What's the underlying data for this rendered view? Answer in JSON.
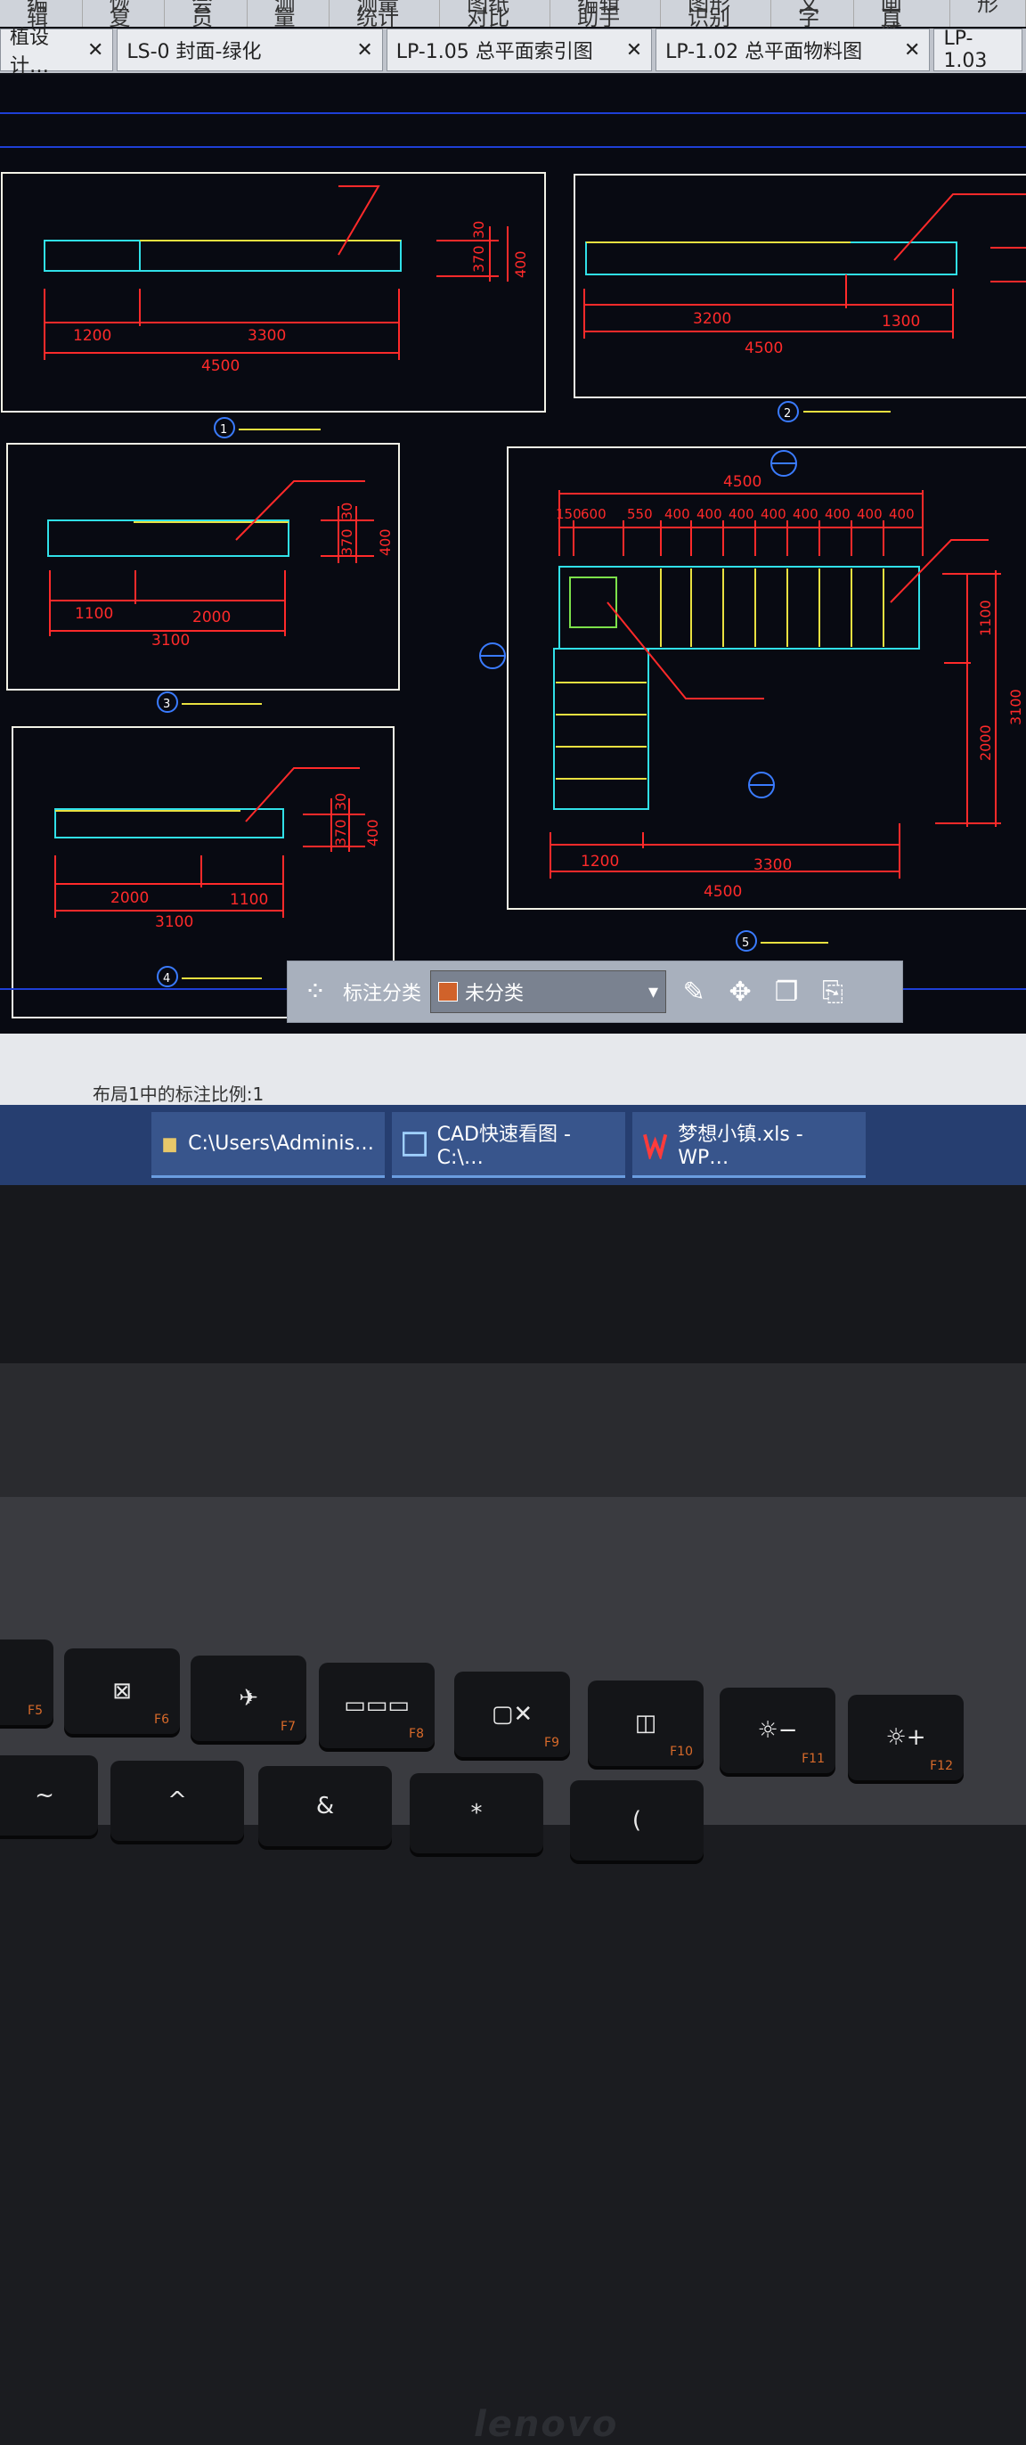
{
  "menu": [
    "编辑",
    "恢复",
    "会员",
    "测量",
    "测量统计",
    "图纸对比",
    "编辑助手",
    "图形识别",
    "文字",
    "画直线",
    "形"
  ],
  "tabs": [
    {
      "label": "植设计…",
      "close": "✕"
    },
    {
      "label": "LS-0 封面-绿化",
      "close": "✕"
    },
    {
      "label": "LP-1.05 总平面索引图",
      "close": "✕"
    },
    {
      "label": "LP-1.02 总平面物料图",
      "close": "✕"
    },
    {
      "label": "LP-1.03",
      "close": ""
    }
  ],
  "drawings": {
    "d1": {
      "dims": [
        "1200",
        "3300",
        "4500",
        "370",
        "30",
        "400"
      ],
      "marker": "1"
    },
    "d2": {
      "dims": [
        "3200",
        "1300",
        "4500"
      ],
      "marker": "2"
    },
    "d3": {
      "dims": [
        "1100",
        "2000",
        "3100",
        "370",
        "30",
        "400"
      ],
      "marker": "3"
    },
    "d4": {
      "dims": [
        "2000",
        "1100",
        "3100",
        "370",
        "30",
        "400"
      ],
      "marker": "4"
    },
    "d5": {
      "dims_top": [
        "150",
        "600",
        "550",
        "400",
        "400",
        "400",
        "400",
        "400",
        "400",
        "400",
        "400"
      ],
      "total_top": "4500",
      "dims_bottom": [
        "1200",
        "3300"
      ],
      "total_bottom": "4500",
      "dims_right": [
        "1100",
        "2000"
      ],
      "total_right": "3100",
      "marker": "5"
    }
  },
  "toolbar": {
    "label": "标注分类",
    "selected": "未分类",
    "swatch_color": "#d0622a"
  },
  "command_line": "布局1中的标注比例:1",
  "taskbar": [
    {
      "label": "C:\\Users\\Adminis…",
      "icon": "folder-icon"
    },
    {
      "label": "CAD快速看图 - C:\\…",
      "icon": "cad-icon"
    },
    {
      "label": "梦想小镇.xls - WP…",
      "icon": "wps-icon"
    }
  ],
  "laptop": {
    "brand": "lenovo"
  },
  "keys": [
    {
      "fn": "F5",
      "glyph": ""
    },
    {
      "fn": "F6",
      "glyph": "⊠"
    },
    {
      "fn": "F7",
      "glyph": "✈"
    },
    {
      "fn": "F8",
      "glyph": "▭▭▭"
    },
    {
      "fn": "F9",
      "glyph": "▢✕"
    },
    {
      "fn": "F10",
      "glyph": "◫"
    },
    {
      "fn": "F11",
      "glyph": "☼−"
    },
    {
      "fn": "F12",
      "glyph": "☼+"
    }
  ],
  "keys_row2": [
    "~",
    "^",
    "&",
    "*",
    "("
  ]
}
